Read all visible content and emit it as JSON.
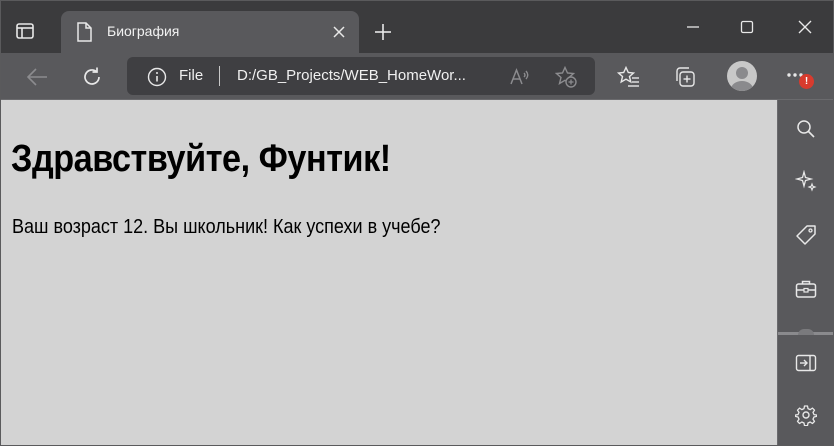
{
  "browser": {
    "tab": {
      "title": "Биография",
      "favicon": "page-icon"
    },
    "new_tab_icon": "plus-icon",
    "window_controls": [
      "minimize-icon",
      "maximize-icon",
      "close-icon"
    ],
    "address_bar": {
      "scheme_label": "File",
      "url": "D:/GB_Projects/WEB_HomeWor...",
      "icons": [
        "info-icon",
        "read-aloud-icon",
        "add-favorite-icon"
      ]
    },
    "toolbar_icons": [
      "back-icon",
      "refresh-icon",
      "favorites-icon",
      "collections-icon",
      "profile-avatar",
      "more-icon"
    ],
    "notification_badge": "!",
    "sidebar_icons": [
      "search-icon",
      "sparkle-icon",
      "tag-icon",
      "toolbox-icon",
      "open-pane-icon",
      "settings-icon"
    ],
    "colors": {
      "frame": "#3b3b3d",
      "toolbar": "#59595c",
      "page_background": "#d3d3d3",
      "badge": "#d83b2e"
    }
  },
  "page": {
    "heading": "Здравствуйте, Фунтик!",
    "paragraph": "Ваш возраст 12. Вы школьник! Как успехи в учебе?"
  }
}
